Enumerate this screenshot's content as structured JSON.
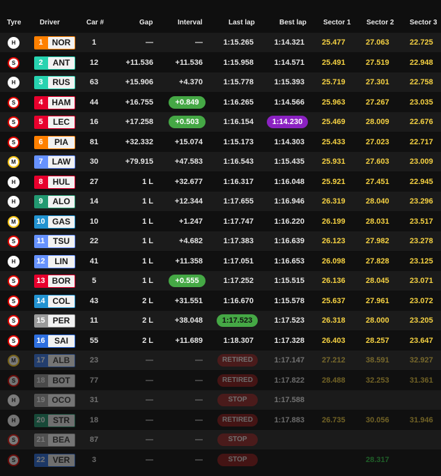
{
  "headers": {
    "tyre": "Tyre",
    "driver": "Driver",
    "car": "Car #",
    "gap": "Gap",
    "interval": "Interval",
    "last": "Last lap",
    "best": "Best lap",
    "s1": "Sector 1",
    "s2": "Sector 2",
    "s3": "Sector 3"
  },
  "colors": {
    "sector_yellow": "#f5d142",
    "sector_green": "#34c94a",
    "purple": "#8b22c2",
    "interval_green": "#45a845",
    "retired": "#8c1b1b",
    "tyre_soft": "#e10600",
    "tyre_medium": "#f5c518",
    "tyre_hard": "#ffffff"
  },
  "rows": [
    {
      "pos": "1",
      "code": "NOR",
      "team_color": "#ff8000",
      "tyre": "H",
      "car": "1",
      "gap": "—",
      "interval": "—",
      "last": "1:15.265",
      "best": "1:14.321",
      "s1": "25.477",
      "s2": "27.063",
      "s3": "22.725"
    },
    {
      "pos": "2",
      "code": "ANT",
      "team_color": "#27d3b0",
      "tyre": "S",
      "car": "12",
      "gap": "+11.536",
      "interval": "+11.536",
      "last": "1:15.958",
      "best": "1:14.571",
      "s1": "25.491",
      "s2": "27.519",
      "s3": "22.948"
    },
    {
      "pos": "3",
      "code": "RUS",
      "team_color": "#27d3b0",
      "tyre": "H",
      "car": "63",
      "gap": "+15.906",
      "interval": "+4.370",
      "last": "1:15.778",
      "best": "1:15.393",
      "s1": "25.719",
      "s2": "27.301",
      "s3": "22.758"
    },
    {
      "pos": "4",
      "code": "HAM",
      "team_color": "#e8002d",
      "tyre": "S",
      "car": "44",
      "gap": "+16.755",
      "interval": "+0.849",
      "interval_pill": "green",
      "last": "1:16.265",
      "best": "1:14.566",
      "s1": "25.963",
      "s2": "27.267",
      "s3": "23.035"
    },
    {
      "pos": "5",
      "code": "LEC",
      "team_color": "#e8002d",
      "tyre": "S",
      "car": "16",
      "gap": "+17.258",
      "interval": "+0.503",
      "interval_pill": "green",
      "last": "1:16.154",
      "best": "1:14.230",
      "best_pill": "purple",
      "s1": "25.469",
      "s2": "28.009",
      "s3": "22.676"
    },
    {
      "pos": "6",
      "code": "PIA",
      "team_color": "#ff8000",
      "tyre": "S",
      "car": "81",
      "gap": "+32.332",
      "interval": "+15.074",
      "last": "1:15.173",
      "best": "1:14.303",
      "s1": "25.433",
      "s2": "27.023",
      "s3": "22.717"
    },
    {
      "pos": "7",
      "code": "LAW",
      "team_color": "#6692ff",
      "tyre": "M",
      "car": "30",
      "gap": "+79.915",
      "interval": "+47.583",
      "last": "1:16.543",
      "best": "1:15.435",
      "s1": "25.931",
      "s2": "27.603",
      "s3": "23.009"
    },
    {
      "pos": "8",
      "code": "HUL",
      "team_color": "#e8002d",
      "tyre": "H",
      "car": "27",
      "gap": "1 L",
      "interval": "+32.677",
      "last": "1:16.317",
      "best": "1:16.048",
      "s1": "25.921",
      "s2": "27.451",
      "s3": "22.945"
    },
    {
      "pos": "9",
      "code": "ALO",
      "team_color": "#229971",
      "tyre": "H",
      "car": "14",
      "gap": "1 L",
      "interval": "+12.344",
      "last": "1:17.655",
      "best": "1:16.946",
      "s1": "26.319",
      "s2": "28.040",
      "s3": "23.296"
    },
    {
      "pos": "10",
      "code": "GAS",
      "team_color": "#2293d1",
      "tyre": "M",
      "car": "10",
      "gap": "1 L",
      "interval": "+1.247",
      "last": "1:17.747",
      "best": "1:16.220",
      "s1": "26.199",
      "s2": "28.031",
      "s3": "23.517"
    },
    {
      "pos": "11",
      "code": "TSU",
      "team_color": "#6692ff",
      "tyre": "S",
      "car": "22",
      "gap": "1 L",
      "interval": "+4.682",
      "last": "1:17.383",
      "best": "1:16.639",
      "s1": "26.123",
      "s2": "27.982",
      "s3": "23.278"
    },
    {
      "pos": "12",
      "code": "LIN",
      "team_color": "#6692ff",
      "tyre": "H",
      "car": "41",
      "gap": "1 L",
      "interval": "+11.358",
      "last": "1:17.051",
      "best": "1:16.653",
      "s1": "26.098",
      "s2": "27.828",
      "s3": "23.125"
    },
    {
      "pos": "13",
      "code": "BOR",
      "team_color": "#e8002d",
      "tyre": "S",
      "car": "5",
      "gap": "1 L",
      "interval": "+0.555",
      "interval_pill": "green",
      "last": "1:17.252",
      "best": "1:15.515",
      "s1": "26.136",
      "s2": "28.045",
      "s3": "23.071"
    },
    {
      "pos": "14",
      "code": "COL",
      "team_color": "#2293d1",
      "tyre": "S",
      "car": "43",
      "gap": "2 L",
      "interval": "+31.551",
      "last": "1:16.670",
      "best": "1:15.578",
      "s1": "25.637",
      "s2": "27.961",
      "s3": "23.072"
    },
    {
      "pos": "15",
      "code": "PER",
      "team_color": "#9a9a9a",
      "tyre": "S",
      "car": "11",
      "gap": "2 L",
      "interval": "+38.048",
      "last": "1:17.523",
      "last_pill": "green",
      "best": "1:17.523",
      "s1": "26.318",
      "s2": "28.000",
      "s3": "23.205"
    },
    {
      "pos": "16",
      "code": "SAI",
      "team_color": "#2e6fe0",
      "tyre": "S",
      "car": "55",
      "gap": "2 L",
      "interval": "+11.689",
      "last": "1:18.307",
      "best": "1:17.328",
      "s1": "26.403",
      "s2": "28.257",
      "s3": "23.647"
    },
    {
      "pos": "17",
      "code": "ALB",
      "team_color": "#2e6fe0",
      "tyre": "M",
      "car": "23",
      "gap": "—",
      "interval": "—",
      "status": "RETIRED",
      "best": "1:17.147",
      "s1": "27.212",
      "s2": "38.591",
      "s3": "32.927",
      "dim": true
    },
    {
      "pos": "18",
      "code": "BOT",
      "team_color": "#9a9a9a",
      "tyre": "S",
      "car": "77",
      "gap": "—",
      "interval": "—",
      "status": "RETIRED",
      "best": "1:17.822",
      "s1": "28.488",
      "s2": "32.253",
      "s3": "31.361",
      "dim": true
    },
    {
      "pos": "19",
      "code": "OCO",
      "team_color": "#9a9a9a",
      "tyre": "H",
      "car": "31",
      "gap": "—",
      "interval": "—",
      "status": "STOP",
      "best": "1:17.588",
      "s1": "",
      "s2": "",
      "s3": "",
      "dim": true
    },
    {
      "pos": "20",
      "code": "STR",
      "team_color": "#229971",
      "tyre": "H",
      "car": "18",
      "gap": "—",
      "interval": "—",
      "status": "RETIRED",
      "best": "1:17.883",
      "s1": "26.735",
      "s2": "30.056",
      "s3": "31.946",
      "dim": true
    },
    {
      "pos": "21",
      "code": "BEA",
      "team_color": "#9a9a9a",
      "tyre": "S",
      "car": "87",
      "gap": "—",
      "interval": "—",
      "status": "STOP",
      "best": "",
      "s1": "",
      "s2": "",
      "s3": "",
      "dim": true
    },
    {
      "pos": "22",
      "code": "VER",
      "team_color": "#2e6fe0",
      "tyre": "S",
      "car": "3",
      "gap": "—",
      "interval": "—",
      "status": "STOP",
      "best": "",
      "s1": "",
      "s2": "28.317",
      "s2_green": true,
      "s3": "",
      "dim": true
    }
  ]
}
